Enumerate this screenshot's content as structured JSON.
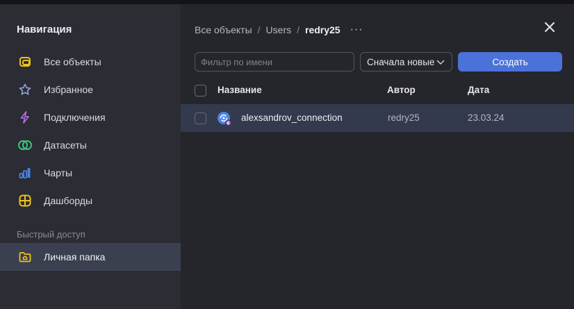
{
  "sidebar": {
    "title": "Навигация",
    "items": [
      {
        "label": "Все объекты",
        "icon": "all-objects-icon",
        "color": "#f0c419"
      },
      {
        "label": "Избранное",
        "icon": "star-icon",
        "color": "#8fa3d6"
      },
      {
        "label": "Подключения",
        "icon": "lightning-icon",
        "color": "#b06ad8"
      },
      {
        "label": "Датасеты",
        "icon": "dataset-rings-icon",
        "color": "#3cc47a"
      },
      {
        "label": "Чарты",
        "icon": "bar-chart-icon",
        "color": "#4a82e6"
      },
      {
        "label": "Дашборды",
        "icon": "dashboard-grid-icon",
        "color": "#f0c419"
      }
    ],
    "quick_access_label": "Быстрый доступ",
    "personal_folder": {
      "label": "Личная папка",
      "icon": "folder-home-icon",
      "color": "#f0c419"
    }
  },
  "breadcrumb": {
    "items": [
      "Все объекты",
      "Users",
      "redry25"
    ],
    "more": "···"
  },
  "toolbar": {
    "filter_placeholder": "Фильтр по имени",
    "filter_value": "",
    "sort_label": "Сначала новые",
    "create_label": "Создать"
  },
  "table": {
    "columns": [
      "Название",
      "Автор",
      "Дата"
    ],
    "rows": [
      {
        "name": "alexsandrov_connection",
        "author": "redry25",
        "date": "23.03.24",
        "icon": "connection-icon"
      }
    ]
  },
  "colors": {
    "accent": "#4a72d8",
    "sidebar_bg": "#2c2c34",
    "main_bg": "#25252c",
    "selected_row_bg": "#333a4d"
  }
}
